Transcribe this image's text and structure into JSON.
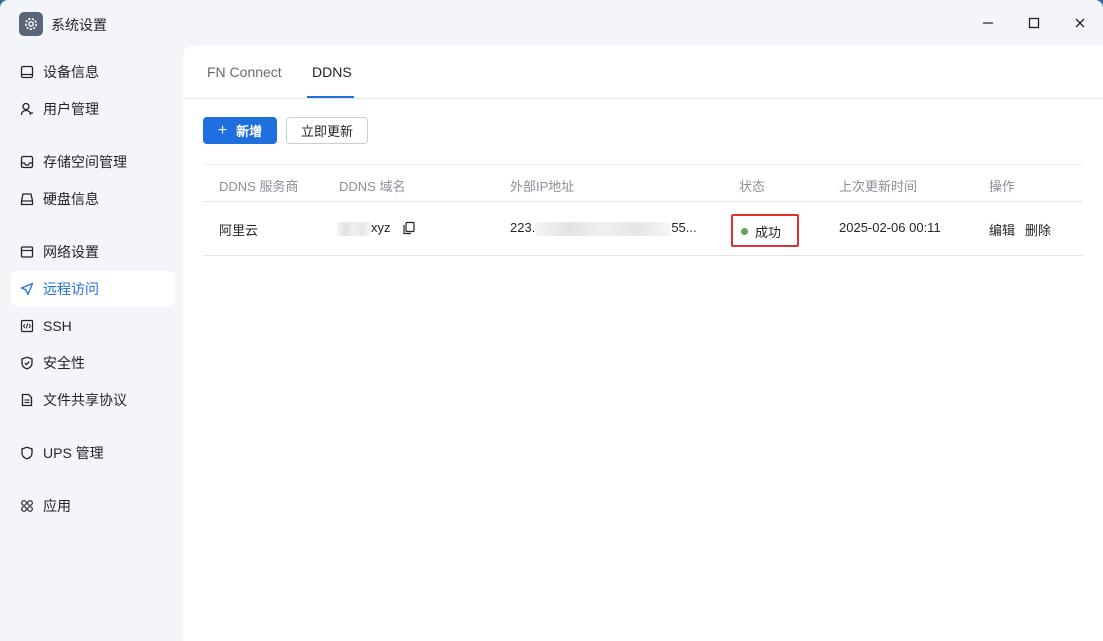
{
  "window": {
    "title": "系统设置"
  },
  "sidebar": {
    "items": [
      {
        "label": "设备信息",
        "icon": "device-icon"
      },
      {
        "label": "用户管理",
        "icon": "user-icon"
      },
      {
        "label": "存储空间管理",
        "icon": "storage-icon"
      },
      {
        "label": "硬盘信息",
        "icon": "disk-icon"
      },
      {
        "label": "网络设置",
        "icon": "network-icon"
      },
      {
        "label": "远程访问",
        "icon": "send-icon"
      },
      {
        "label": "SSH",
        "icon": "code-icon"
      },
      {
        "label": "安全性",
        "icon": "shield-check-icon"
      },
      {
        "label": "文件共享协议",
        "icon": "file-icon"
      },
      {
        "label": "UPS 管理",
        "icon": "shield-icon"
      },
      {
        "label": "应用",
        "icon": "apps-icon"
      }
    ],
    "active_index": 5
  },
  "tabs": [
    {
      "label": "FN Connect"
    },
    {
      "label": "DDNS"
    }
  ],
  "toolbar": {
    "add_label": "新增",
    "update_label": "立即更新"
  },
  "table": {
    "headers": [
      "DDNS 服务商",
      "DDNS 域名",
      "外部IP地址",
      "状态",
      "上次更新时间",
      "操作"
    ],
    "rows": [
      {
        "provider": "阿里云",
        "domain_suffix": "xyz",
        "ip_prefix": "223.",
        "ip_suffix": "55...",
        "status": "成功",
        "updated": "2025-02-06 00:11",
        "edit": "编辑",
        "delete": "删除"
      }
    ]
  },
  "colors": {
    "accent": "#1f6fde",
    "status_success": "#5aa854",
    "highlight_box": "#e03131"
  }
}
